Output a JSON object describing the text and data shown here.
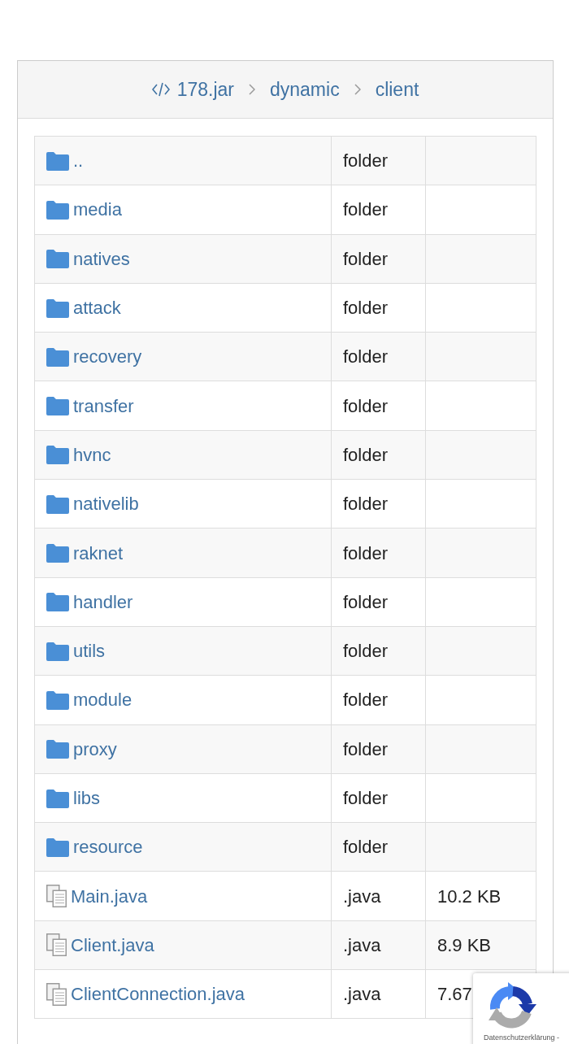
{
  "breadcrumb": [
    {
      "kind": "archive",
      "label": "178.jar"
    },
    {
      "kind": "folder",
      "label": "dynamic"
    },
    {
      "kind": "folder",
      "label": "client"
    }
  ],
  "table": {
    "rows": [
      {
        "kind": "folder",
        "name": "..",
        "type": "folder"
      },
      {
        "kind": "folder",
        "name": "media",
        "type": "folder"
      },
      {
        "kind": "folder",
        "name": "natives",
        "type": "folder"
      },
      {
        "kind": "folder",
        "name": "attack",
        "type": "folder"
      },
      {
        "kind": "folder",
        "name": "recovery",
        "type": "folder"
      },
      {
        "kind": "folder",
        "name": "transfer",
        "type": "folder"
      },
      {
        "kind": "folder",
        "name": "hvnc",
        "type": "folder"
      },
      {
        "kind": "folder",
        "name": "nativelib",
        "type": "folder"
      },
      {
        "kind": "folder",
        "name": "raknet",
        "type": "folder"
      },
      {
        "kind": "folder",
        "name": "handler",
        "type": "folder"
      },
      {
        "kind": "folder",
        "name": "utils",
        "type": "folder"
      },
      {
        "kind": "folder",
        "name": "module",
        "type": "folder"
      },
      {
        "kind": "folder",
        "name": "proxy",
        "type": "folder"
      },
      {
        "kind": "folder",
        "name": "libs",
        "type": "folder"
      },
      {
        "kind": "folder",
        "name": "resource",
        "type": "folder"
      },
      {
        "kind": "file",
        "name": "Main.java",
        "type": ".java",
        "size": "10.2 KB"
      },
      {
        "kind": "file",
        "name": "Client.java",
        "type": ".java",
        "size": "8.9 KB"
      },
      {
        "kind": "file",
        "name": "ClientConnection.java",
        "type": ".java",
        "size": "7.67"
      }
    ]
  },
  "privacy_badge": {
    "link": "Datenschutzerklärung -"
  }
}
